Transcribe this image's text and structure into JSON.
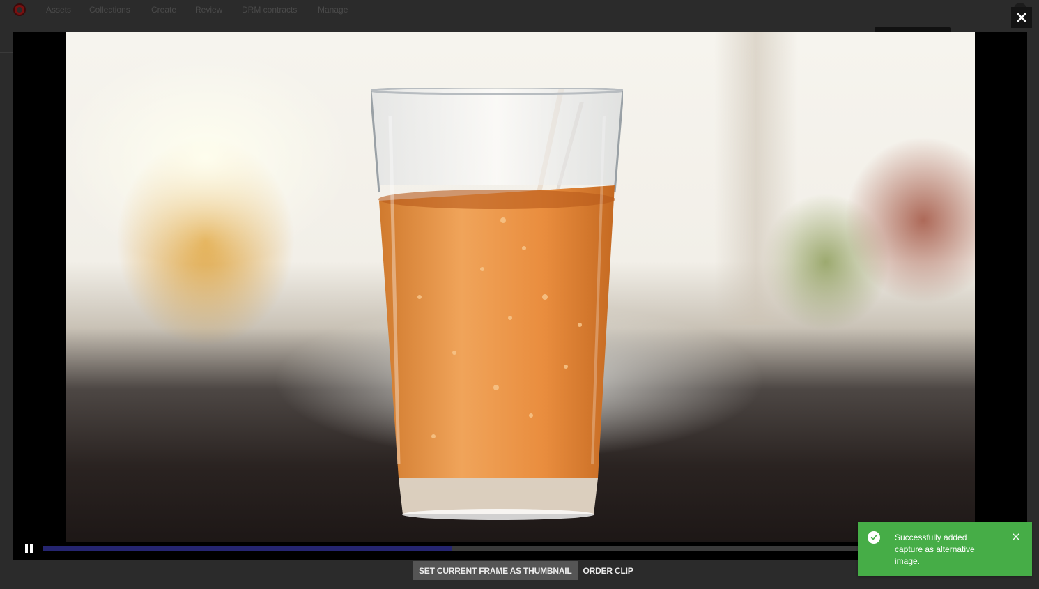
{
  "nav": {
    "items": [
      "Assets",
      "Collections",
      "Create",
      "Review",
      "DRM contracts",
      "Manage"
    ]
  },
  "player": {
    "state": "playing",
    "progress_fraction": 0.49
  },
  "actions": {
    "set_thumbnail_label": "SET CURRENT FRAME AS THUMBNAIL",
    "order_clip_label": "ORDER CLIP"
  },
  "toast": {
    "message": "Successfully added capture as alternative image.",
    "type": "success"
  },
  "colors": {
    "toast_bg": "#46ad47",
    "progress_fill": "#252570",
    "overlay_bg": "#2b2b2b"
  },
  "icons": {
    "close": "close-icon",
    "pause": "pause-icon",
    "check": "check-circle-icon",
    "toast_close": "close-icon"
  }
}
